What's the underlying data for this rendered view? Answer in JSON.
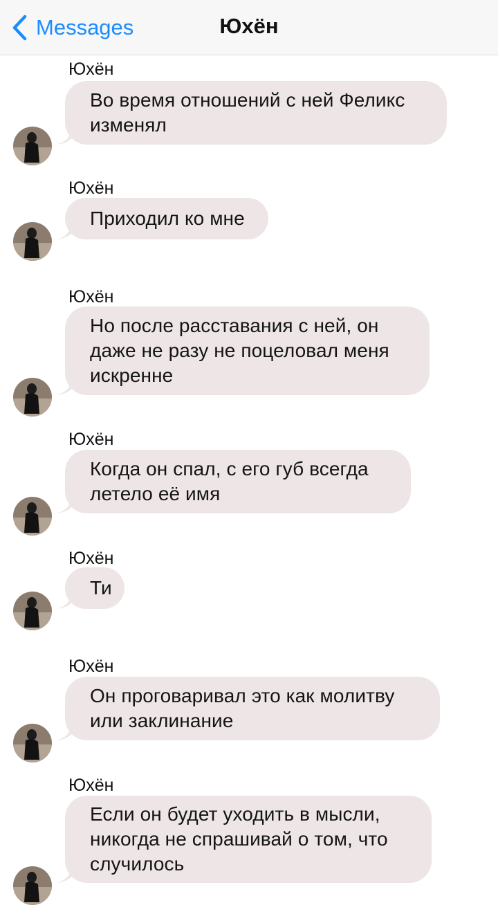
{
  "nav": {
    "back_label": "Messages",
    "title": "Юхён",
    "accent": "#1a8cff"
  },
  "bubble_color": "#eee6e6",
  "messages": [
    {
      "sender": "Юхён",
      "lines": [
        "Во время отношений с ней Феликс",
        "изменял"
      ]
    },
    {
      "sender": "Юхён",
      "lines": [
        "Приходил ко мне"
      ]
    },
    {
      "sender": "Юхён",
      "lines": [
        "Но после расставания с ней, он",
        "даже не разу не поцеловал меня",
        "искренне"
      ]
    },
    {
      "sender": "Юхён",
      "lines": [
        "Когда он спал, с его губ всегда",
        "летело её имя"
      ]
    },
    {
      "sender": "Юхён",
      "lines": [
        "Ти"
      ]
    },
    {
      "sender": "Юхён",
      "lines": [
        "Он проговаривал это как молитву",
        "или заклинание"
      ]
    },
    {
      "sender": "Юхён",
      "lines": [
        "Если он будет уходить в мысли,",
        "никогда не спрашивай о том, что",
        "случилось"
      ]
    }
  ]
}
